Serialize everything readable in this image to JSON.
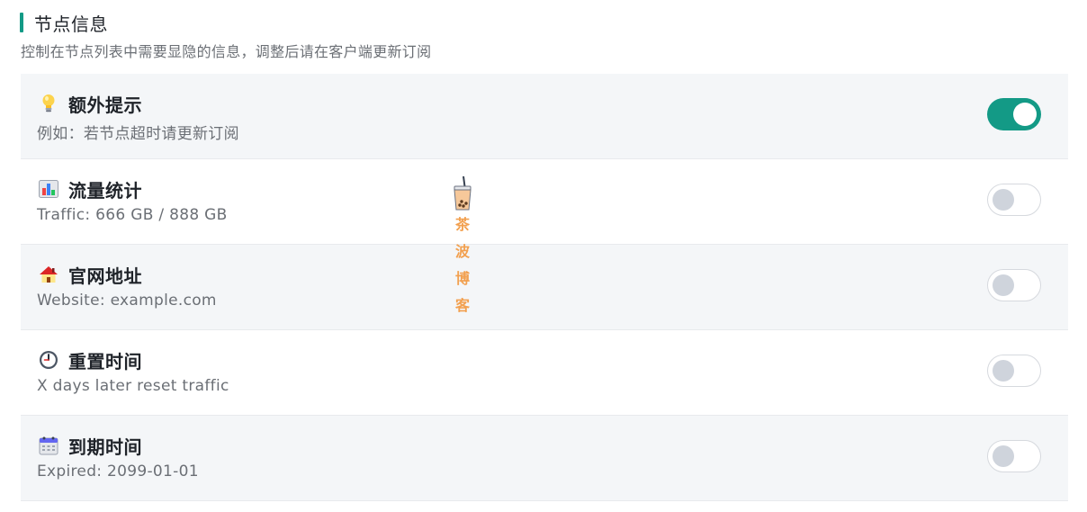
{
  "section": {
    "title": "节点信息",
    "description": "控制在节点列表中需要显隐的信息，调整后请在客户端更新订阅",
    "accent_color": "#139a86"
  },
  "items": [
    {
      "icon": "lightbulb-icon",
      "title": "额外提示",
      "subtitle": "例如：若节点超时请更新订阅",
      "enabled": true
    },
    {
      "icon": "bar-chart-icon",
      "title": "流量统计",
      "subtitle": "Traffic: 666 GB / 888 GB",
      "enabled": false
    },
    {
      "icon": "house-icon",
      "title": "官网地址",
      "subtitle": "Website: example.com",
      "enabled": false
    },
    {
      "icon": "clock-icon",
      "title": "重置时间",
      "subtitle": "X days later reset traffic",
      "enabled": false
    },
    {
      "icon": "calendar-icon",
      "title": "到期时间",
      "subtitle": "Expired: 2099-01-01",
      "enabled": false
    }
  ],
  "watermark": {
    "line1": "茶波",
    "line2": "博客",
    "icon": "bubble-tea-icon",
    "color": "#f2a04f"
  },
  "colors": {
    "toggle_on": "#139a86",
    "toggle_off_knob": "#cfd4dc",
    "row_alt_bg": "#f4f6f8"
  }
}
